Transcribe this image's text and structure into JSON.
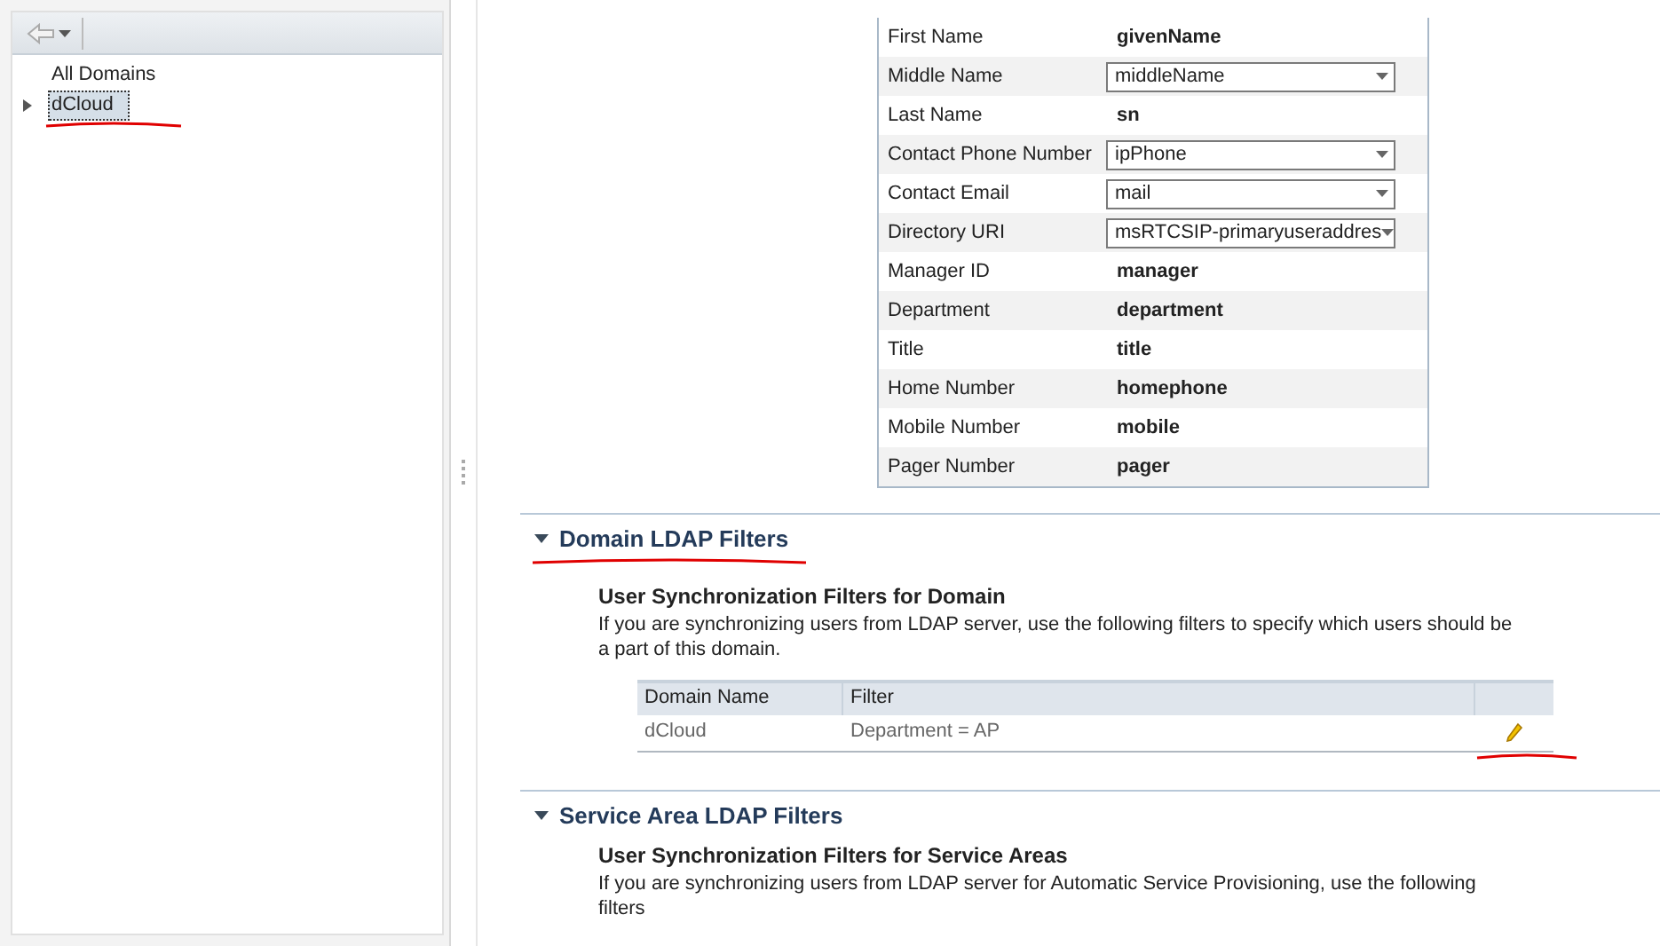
{
  "tree": {
    "items": [
      {
        "label": "All Domains",
        "selected": false,
        "expandable": false
      },
      {
        "label": "dCloud",
        "selected": true,
        "expandable": true
      }
    ]
  },
  "attributes": [
    {
      "label": "First Name",
      "kind": "text",
      "value": "givenName"
    },
    {
      "label": "Middle Name",
      "kind": "select",
      "value": "middleName"
    },
    {
      "label": "Last Name",
      "kind": "text",
      "value": "sn"
    },
    {
      "label": "Contact Phone Number",
      "kind": "select",
      "value": "ipPhone"
    },
    {
      "label": "Contact Email",
      "kind": "select",
      "value": "mail"
    },
    {
      "label": "Directory URI",
      "kind": "select",
      "value": "msRTCSIP-primaryuseraddres"
    },
    {
      "label": "Manager ID",
      "kind": "text",
      "value": "manager"
    },
    {
      "label": "Department",
      "kind": "text",
      "value": "department"
    },
    {
      "label": "Title",
      "kind": "text",
      "value": "title"
    },
    {
      "label": "Home Number",
      "kind": "text",
      "value": "homephone"
    },
    {
      "label": "Mobile Number",
      "kind": "text",
      "value": "mobile"
    },
    {
      "label": "Pager Number",
      "kind": "text",
      "value": "pager"
    }
  ],
  "sections": [
    {
      "title": "Domain LDAP Filters",
      "expanded": true,
      "heading": "User Synchronization Filters for Domain",
      "description": "If you are synchronizing users from LDAP server, use the following filters to specify which users should be a part of this domain.",
      "table": {
        "columns": [
          "Domain Name",
          "Filter"
        ],
        "rows": [
          [
            "dCloud",
            "Department = AP"
          ]
        ]
      }
    },
    {
      "title": "Service Area LDAP Filters",
      "expanded": true,
      "heading": "User Synchronization Filters for Service Areas",
      "description": "If you are synchronizing users from LDAP server for Automatic Service Provisioning, use the following filters"
    }
  ]
}
